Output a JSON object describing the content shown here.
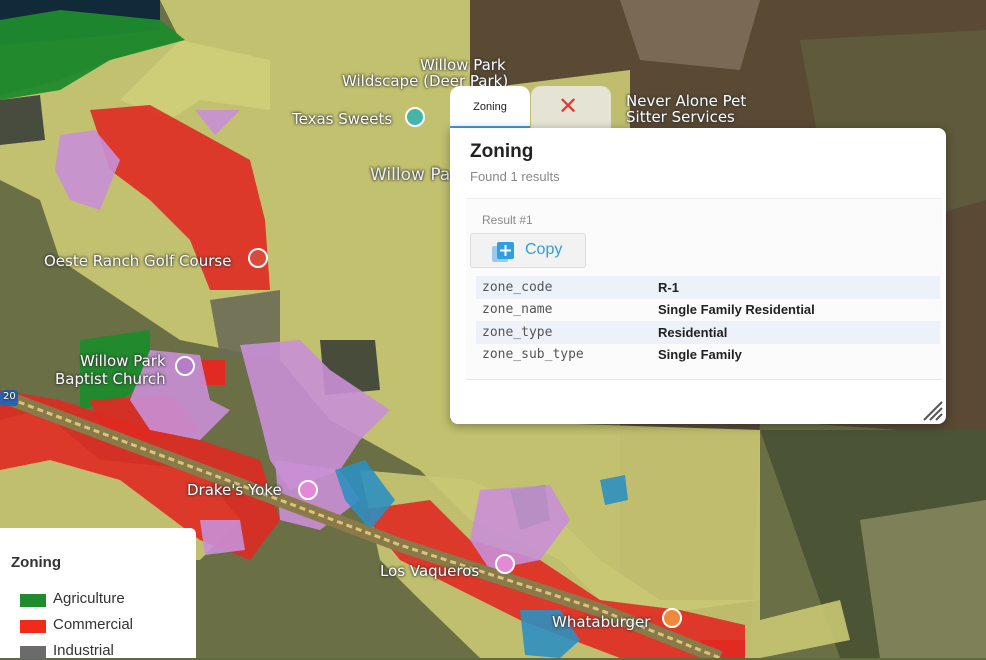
{
  "map": {
    "pois": [
      {
        "id": "willow-park-n",
        "label": "Willow Park"
      },
      {
        "id": "wildscape",
        "label": "Wildscape (Deer Park)"
      },
      {
        "id": "texas-sweets",
        "label": "Texas Sweets"
      },
      {
        "id": "never-alone-1",
        "label": "Never Alone Pet"
      },
      {
        "id": "never-alone-2",
        "label": "Sitter Services"
      },
      {
        "id": "willow-pa",
        "label": "Willow Pa"
      },
      {
        "id": "oeste",
        "label": "Oeste Ranch Golf Course"
      },
      {
        "id": "willow-baptist-1",
        "label": "Willow Park"
      },
      {
        "id": "willow-baptist-2",
        "label": "Baptist Church"
      },
      {
        "id": "drakes",
        "label": "Drake's Yoke"
      },
      {
        "id": "vaqueros",
        "label": "Los Vaqueros"
      },
      {
        "id": "whataburger",
        "label": "Whataburger"
      },
      {
        "id": "highway",
        "label": "20"
      }
    ]
  },
  "popup": {
    "tab_label": "Zoning",
    "close_icon": "close-icon",
    "title": "Zoning",
    "subtitle": "Found 1 results",
    "result_label": "Result #1",
    "copy_label": "Copy",
    "attributes": [
      {
        "key": "zone_code",
        "value": "R-1"
      },
      {
        "key": "zone_name",
        "value": "Single Family Residential"
      },
      {
        "key": "zone_type",
        "value": "Residential"
      },
      {
        "key": "zone_sub_type",
        "value": "Single Family"
      }
    ]
  },
  "legend": {
    "title": "Zoning",
    "items": [
      {
        "label": "Agriculture",
        "color": "#1e8c2e"
      },
      {
        "label": "Commercial",
        "color": "#f22a1a"
      },
      {
        "label": "Industrial",
        "color": "#6b6b6b"
      }
    ]
  },
  "colors": {
    "residential": "#cfd07a",
    "commercial": "#e02a22",
    "mixed": "#c98fd6",
    "agriculture": "#1f8a2c",
    "water": "#2e8fc0",
    "accent": "#2e9fe0"
  }
}
